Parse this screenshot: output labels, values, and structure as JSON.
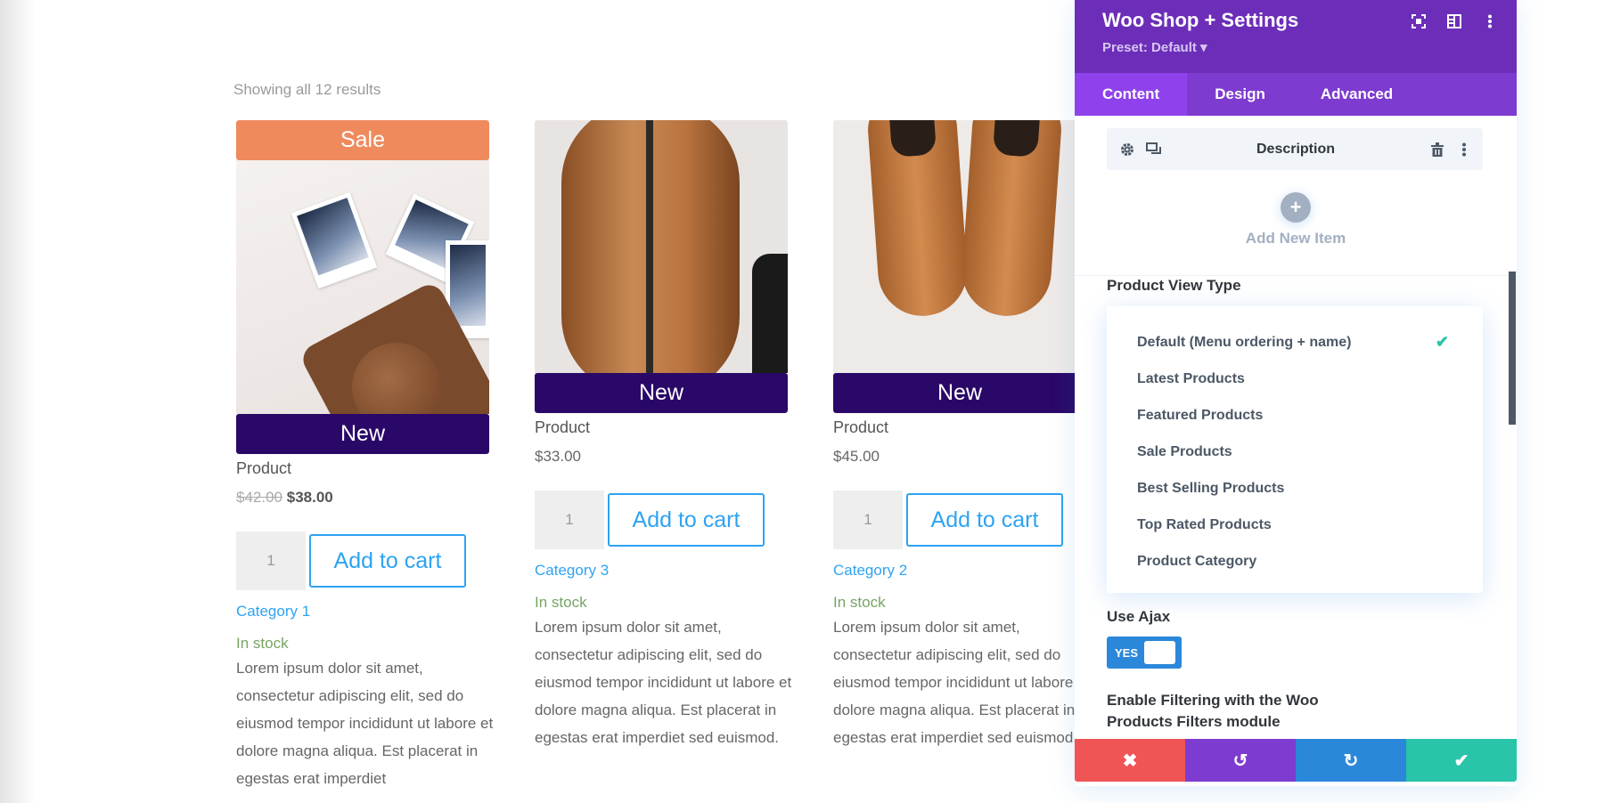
{
  "shop": {
    "results_text": "Showing all 12 results",
    "products": [
      {
        "top_badge": "Sale",
        "bottom_badge": "New",
        "title": "Product",
        "price_old": "$42.00",
        "price": "$38.00",
        "quantity": "1",
        "add_to_cart": "Add to cart",
        "category": "Category 1",
        "stock": "In stock",
        "description": "Lorem ipsum dolor sit amet, consectetur adipiscing elit, sed do eiusmod tempor incididunt ut labore et dolore magna aliqua. Est placerat in egestas erat imperdiet"
      },
      {
        "bottom_badge": "New",
        "title": "Product",
        "price": "$33.00",
        "quantity": "1",
        "add_to_cart": "Add to cart",
        "category": "Category 3",
        "stock": "In stock",
        "description": "Lorem ipsum dolor sit amet, consectetur adipiscing elit, sed do eiusmod tempor incididunt ut labore et dolore magna aliqua. Est placerat in egestas erat imperdiet sed euismod."
      },
      {
        "bottom_badge": "New",
        "title": "Product",
        "price": "$45.00",
        "quantity": "1",
        "add_to_cart": "Add to cart",
        "category": "Category 2",
        "stock": "In stock",
        "description": "Lorem ipsum dolor sit amet, consectetur adipiscing elit, sed do eiusmod tempor incididunt ut labore et dolore magna aliqua. Est placerat in egestas erat imperdiet sed euismod."
      }
    ]
  },
  "panel": {
    "title": "Woo Shop + Settings",
    "preset": "Preset: Default ▾",
    "header_icons": [
      "focus-icon",
      "layout-icon",
      "more-icon"
    ],
    "tabs": [
      {
        "label": "Content",
        "active": true
      },
      {
        "label": "Design",
        "active": false
      },
      {
        "label": "Advanced",
        "active": false
      }
    ],
    "item": {
      "label": "Description"
    },
    "add_new_item": "Add New Item",
    "product_view_type": {
      "label": "Product View Type",
      "selected": "Default (Menu ordering + name)",
      "options": [
        "Default (Menu ordering + name)",
        "Latest Products",
        "Featured Products",
        "Sale Products",
        "Best Selling Products",
        "Top Rated Products",
        "Product Category"
      ]
    },
    "use_ajax": {
      "label": "Use Ajax",
      "value": "YES"
    },
    "enable_filtering": {
      "label": "Enable Filtering with the Woo Products Filters module"
    },
    "actions": {
      "cancel": "✖",
      "undo": "↺",
      "redo": "↻",
      "save": "✔"
    }
  },
  "colors": {
    "panel_header": "#6c2eb9",
    "tabs_bg": "#7d3bcf",
    "tab_active": "#8f42ec",
    "sale_badge": "#ef8a5d",
    "new_badge": "#2a0868",
    "link_blue": "#2ea3f2",
    "stock_green": "#77a464",
    "cancel": "#ef5555",
    "undo": "#7e3bd0",
    "redo": "#2b87da",
    "save": "#29c4a9"
  }
}
